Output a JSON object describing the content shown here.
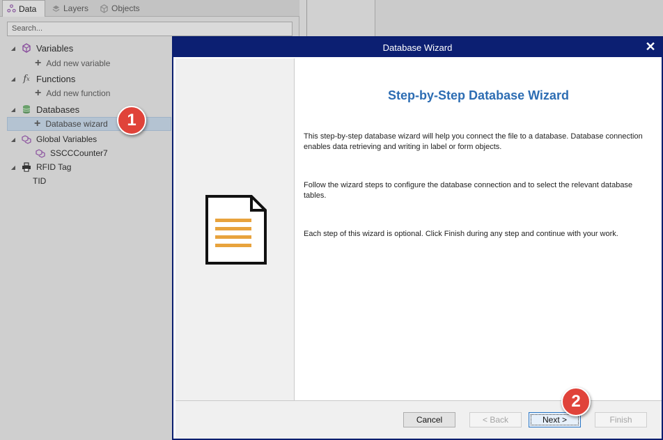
{
  "left_panel": {
    "tabs": [
      {
        "label": "Data",
        "icon": "data-icon"
      },
      {
        "label": "Layers",
        "icon": "layers-icon"
      },
      {
        "label": "Objects",
        "icon": "objects-icon"
      }
    ],
    "search_placeholder": "Search...",
    "tree": {
      "variables": "Variables",
      "add_variable": "Add new variable",
      "functions": "Functions",
      "add_function": "Add new function",
      "databases": "Databases",
      "database_wizard": "Database wizard",
      "global_variables": "Global Variables",
      "ssccounter": "SSCCCounter7",
      "rfid_tag": "RFID Tag",
      "tid": "TID"
    }
  },
  "markers": {
    "one": "1",
    "two": "2"
  },
  "dialog": {
    "title": "Database Wizard",
    "close_glyph": "✕",
    "heading": "Step-by-Step Database Wizard",
    "paragraphs": [
      "This step-by-step database wizard will help you connect the file to a database. Database connection enables data retrieving and writing in label or form objects.",
      "Follow the wizard steps to configure the database connection and to select the relevant database tables.",
      "Each step of this wizard is optional. Click Finish during any step and continue with your work."
    ],
    "buttons": {
      "cancel": "Cancel",
      "back": "< Back",
      "next": "Next >",
      "finish": "Finish"
    }
  },
  "colors": {
    "titlebar": "#0c1f72",
    "heading": "#2d6db3",
    "marker": "#e0433a",
    "doc_lines": "#e8a33d"
  }
}
